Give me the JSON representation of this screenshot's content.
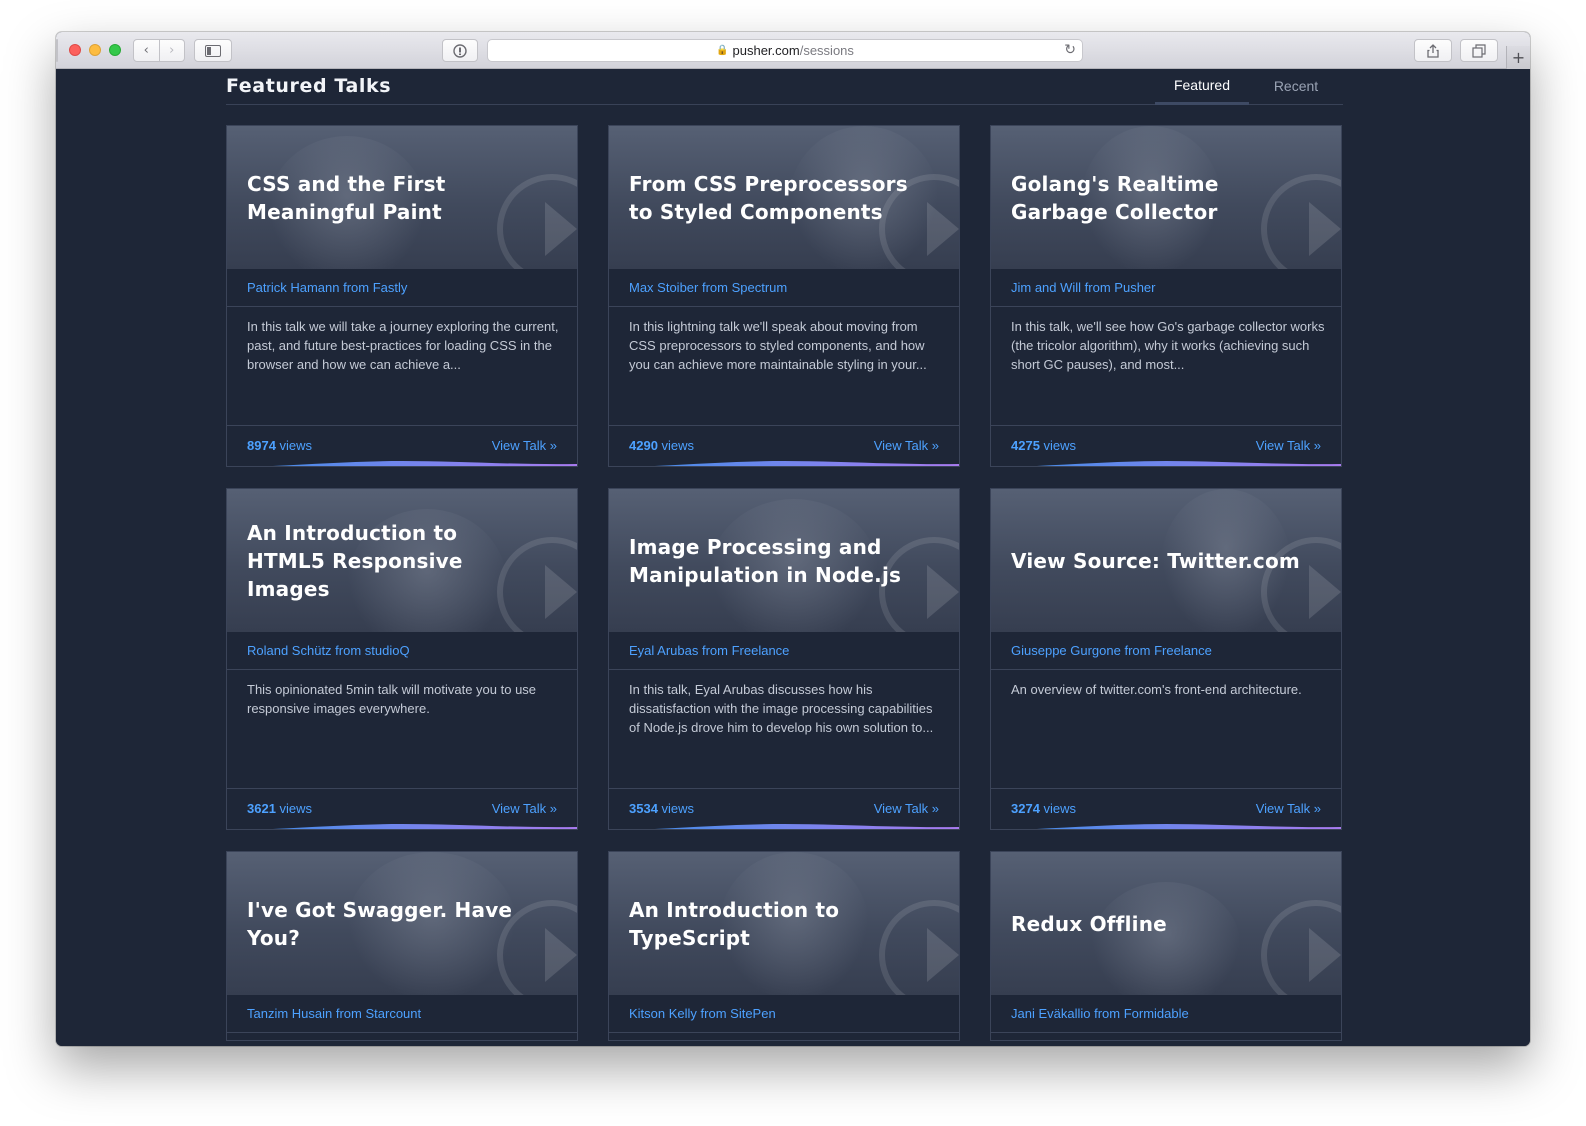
{
  "browser": {
    "url_host": "pusher.com",
    "url_path": "/sessions"
  },
  "page": {
    "title": "Featured Talks",
    "tabs": [
      {
        "label": "Featured",
        "active": true
      },
      {
        "label": "Recent",
        "active": false
      }
    ]
  },
  "cards": [
    {
      "title": "CSS and the First Meaningful Paint",
      "speaker": "Patrick Hamann from Fastly",
      "description": "In this talk we will take a journey exploring the current, past, and future best-practices for loading CSS in the browser and how we can achieve a...",
      "views_number": "8974",
      "views_word": "views",
      "link": "View Talk »"
    },
    {
      "title": "From CSS Preprocessors to Styled Components",
      "speaker": "Max Stoiber from Spectrum",
      "description": "In this lightning talk we'll speak about moving from CSS preprocessors to styled components, and how you can achieve more maintainable styling in your...",
      "views_number": "4290",
      "views_word": "views",
      "link": "View Talk »"
    },
    {
      "title": "Golang's Realtime Garbage Collector",
      "speaker": "Jim and Will from Pusher",
      "description": "In this talk, we'll see how Go's garbage collector works (the tricolor algorithm), why it works (achieving such short GC pauses), and most...",
      "views_number": "4275",
      "views_word": "views",
      "link": "View Talk »"
    },
    {
      "title": "An Introduction to HTML5 Responsive Images",
      "speaker": "Roland Schütz from studioQ",
      "description": "This opinionated 5min talk will motivate you to use responsive images everywhere.",
      "views_number": "3621",
      "views_word": "views",
      "link": "View Talk »"
    },
    {
      "title": "Image Processing and Manipulation in Node.js",
      "speaker": "Eyal Arubas from Freelance",
      "description": "In this talk, Eyal Arubas discusses how his dissatisfaction with the image processing capabilities of Node.js drove him to develop his own solution to...",
      "views_number": "3534",
      "views_word": "views",
      "link": "View Talk »"
    },
    {
      "title": "View Source: Twitter.com",
      "speaker": "Giuseppe Gurgone from Freelance",
      "description": "An overview of twitter.com's front-end architecture.",
      "views_number": "3274",
      "views_word": "views",
      "link": "View Talk »"
    },
    {
      "title": "I've Got Swagger. Have You?",
      "speaker": "Tanzim Husain from Starcount"
    },
    {
      "title": "An Introduction to TypeScript",
      "speaker": "Kitson Kelly from SitePen"
    },
    {
      "title": "Redux Offline",
      "speaker": "Jani Eväkallio from Formidable"
    }
  ],
  "colors": {
    "background": "#1e2637",
    "link": "#4da1ff",
    "wave_start": "#3a8fe8",
    "wave_end": "#a97bf0"
  },
  "icons": {
    "back": "chevron-left-icon",
    "forward": "chevron-right-icon",
    "sidebar": "sidebar-icon",
    "reader": "reader-icon",
    "lock": "lock-icon",
    "reload": "reload-icon",
    "share": "share-icon",
    "tabs": "tabs-icon",
    "new_tab": "plus-icon",
    "play": "play-icon"
  }
}
